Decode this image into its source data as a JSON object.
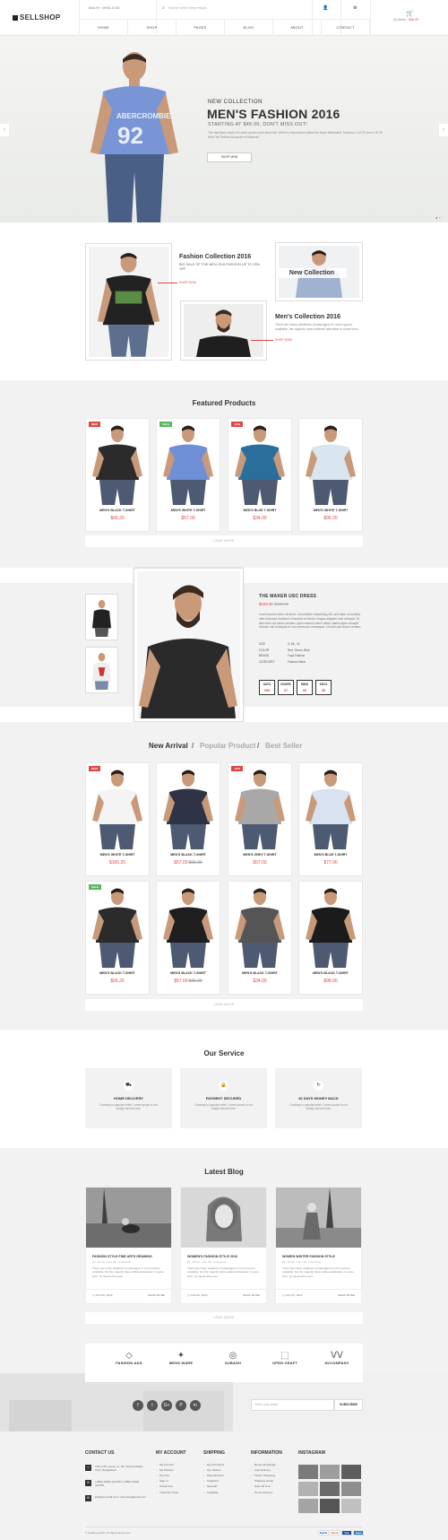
{
  "header": {
    "logo": "SELLSHOP",
    "hours": "Mon-Fri : 09:00-17:00",
    "search_placeholder": "Search within these results",
    "cart_items": "(2) items - ",
    "cart_total": "$46.00",
    "nav": [
      "HOME",
      "SHOP",
      "PAGES",
      "BLOG",
      "ABOUT",
      "CONTACT"
    ]
  },
  "hero": {
    "subtitle": "NEW COLLECTION",
    "title": "MEN'S FASHION 2016",
    "price": "STARTING AT $45.00, DON'T MISS OUT!",
    "desc": "The standard chunk of Lorem Ipsum used since the 1500s is reproduced below for those interested. Sections 1.10.32 and 1.10.33 from \"de Finibus Bonorum et Malorum\"",
    "button": "SHOP NOW"
  },
  "collections": {
    "c1_title": "Fashion Collection 2016",
    "c1_desc": "BIG SALE OF THE MEN 2016 FASHION UP TO 25% OFF",
    "c1_link": "SHOP NOW",
    "new_label": "New Collection",
    "c2_title": "Men's Collection 2016",
    "c2_desc": "There are many variations of passages of Lorem Ipsum available, the majority have suffered alteration in some form.",
    "c2_link": "SHOP NOW"
  },
  "featured": {
    "title": "Featured Products",
    "items": [
      {
        "name": "MEN'S BLACK T-SHIRT",
        "price": "$65.20",
        "badge": "NEW",
        "badge_color": "#e04848",
        "shirt": "#2b2b2b"
      },
      {
        "name": "MEN'S WHITE T-SHIRT",
        "price": "$57.00",
        "badge": "SALE",
        "badge_color": "#5cb85c",
        "shirt": "#6f8fd6"
      },
      {
        "name": "MEN'S BLUE T-SHIRT",
        "price": "$34.00",
        "badge": "-15%",
        "badge_color": "#e04848",
        "shirt": "#2a6f9c"
      },
      {
        "name": "MEN'S WHITE T-SHIRT",
        "price": "$96.20",
        "badge": "",
        "badge_color": "",
        "shirt": "#d9e6ef"
      }
    ],
    "load_more": "LOAD MORE"
  },
  "detail": {
    "title": "THE MAKER USC DRESS",
    "price": "$169.00",
    "old_price": "$189.00",
    "desc": "Lorem ipsum dolor sit amet, consectetur adipiscing elit, sed diam nonummy nibh euismod tincidunt ut laoreet et dolore magna aliquam erat volutpat. Ut wisi enim ad minim veniam, quis nostrud exerci tation ullamcorper suscipit lobortis nisl ut aliquip ex ea commodo consequat. Ut enim ad minim veniam.",
    "rows": [
      {
        "k": "SIZE",
        "v": "S, ML, XL"
      },
      {
        "k": "COLOR",
        "v": "Red, Green, Blue"
      },
      {
        "k": "BRAND",
        "v": "Fuya Fashion"
      },
      {
        "k": "CATEGORY",
        "v": "Fashion Mens"
      }
    ],
    "countdown": [
      {
        "lbl": "DAYS",
        "num": "400"
      },
      {
        "lbl": "HOURS",
        "num": "07"
      },
      {
        "lbl": "MINS",
        "num": "06"
      },
      {
        "lbl": "SECS",
        "num": "35"
      }
    ]
  },
  "tabs": {
    "new": "New Arrival",
    "sep": "/",
    "popular": "Popular Product",
    "best": "Best Seller"
  },
  "arrivals": {
    "row1": [
      {
        "name": "MEN'S WHITE T-SHIRT",
        "price": "$165.20",
        "old": "",
        "badge": "NEW",
        "badge_color": "#e04848",
        "shirt": "#f4f4f4"
      },
      {
        "name": "MEN'S BLACK T-SHIRT",
        "price": "$57.00",
        "old": "$65.00",
        "badge": "",
        "badge_color": "",
        "shirt": "#2e3446"
      },
      {
        "name": "MEN'S GREY T-SHIRT",
        "price": "$67.00",
        "old": "",
        "badge": "-15%",
        "badge_color": "#e04848",
        "shirt": "#a8a8a8"
      },
      {
        "name": "MEN'S BLUE T-SHIRT",
        "price": "$77.00",
        "old": "",
        "badge": "",
        "badge_color": "",
        "shirt": "#d9e2f0"
      }
    ],
    "row2": [
      {
        "name": "MEN'S BLACK T-SHIRT",
        "price": "$65.20",
        "old": "",
        "badge": "SALE",
        "badge_color": "#5cb85c",
        "shirt": "#2b2b2b"
      },
      {
        "name": "MEN'S BLACK T-SHIRT",
        "price": "$57.00",
        "old": "$65.00",
        "badge": "",
        "badge_color": "",
        "shirt": "#1e1e1e"
      },
      {
        "name": "MEN'S BLACK T-SHIRT",
        "price": "$34.00",
        "old": "",
        "badge": "",
        "badge_color": "",
        "shirt": "#555555"
      },
      {
        "name": "MEN'S BLACK T-SHIRT",
        "price": "$98.00",
        "old": "",
        "badge": "",
        "badge_color": "",
        "shirt": "#1b1b1b"
      }
    ],
    "load_more": "LOAD MORE"
  },
  "service": {
    "title": "Our Service",
    "items": [
      {
        "icon": "truck-icon",
        "glyph": "⛟",
        "title": "HOME DELIVERY",
        "desc": "Contrary to popular belief, Lorem Ipsum is not simply random text."
      },
      {
        "icon": "lock-icon",
        "glyph": "🔒",
        "title": "PAYMENT SECURED",
        "desc": "Contrary to popular belief, Lorem Ipsum is not simply random text."
      },
      {
        "icon": "refresh-icon",
        "glyph": "↻",
        "title": "30 DAYS MONEY BACK",
        "desc": "Contrary to popular belief, Lorem Ipsum is not simply random text."
      }
    ]
  },
  "blog": {
    "title": "Latest Blog",
    "items": [
      {
        "title": "FASHION STYLE FINE ARTS DRAWING",
        "meta": "By : Admin - Like: 48 - Comments",
        "desc": "There are many variations of passages of Lorem Ipsum available, but the majority have suffered alteration in some form, by injected humour...",
        "date": "JUN 25, 2016",
        "more": "READ MORE"
      },
      {
        "title": "WOMEN'S FASHION STYLE 2016",
        "meta": "By : Admin - Like: 48 - Comments",
        "desc": "There are many variations of passages of Lorem Ipsum available, but the majority have suffered alteration in some form, by injected humour...",
        "date": "JUN 25, 2016",
        "more": "READ MORE"
      },
      {
        "title": "WOMEN WINTER FASHION STYLE",
        "meta": "By : Admin - Like: 48 - Comments",
        "desc": "There are many variations of passages of Lorem Ipsum available, but the majority have suffered alteration in some form, by injected humour...",
        "date": "JUN 25, 2016",
        "more": "READ MORE"
      }
    ],
    "load_more": "LOAD MORE"
  },
  "brands": [
    {
      "name": "FASHION ADD",
      "glyph": "◇"
    },
    {
      "name": "MENS WARE",
      "glyph": "✦"
    },
    {
      "name": "SUBASH",
      "glyph": "◎"
    },
    {
      "name": "OPEN CRAFT",
      "glyph": "⬚"
    },
    {
      "name": "AVCOMPANY",
      "glyph": "ᐯᐯ"
    }
  ],
  "social": {
    "icons": [
      "f",
      "t",
      "G+",
      "P",
      "in"
    ],
    "newsletter_placeholder": "Enter your email",
    "subscribe": "SUBSCRIBE"
  },
  "footer": {
    "contact_title": "CONTACT US",
    "contact": [
      {
        "icon": "map-pin-icon",
        "glyph": "⌂",
        "text": "This is 85, House no. 02, Victoria Dhaka 1217, Bangladesh"
      },
      {
        "icon": "phone-icon",
        "glyph": "✆",
        "text": "(+880) 19002 421758 / (+880) 19002 421759"
      },
      {
        "icon": "mail-icon",
        "glyph": "✉",
        "text": "info@yourmail.com / username@mail.com"
      }
    ],
    "cols": [
      {
        "title": "MY ACCOUNT",
        "items": [
          "My Account",
          "My Wishlist",
          "My Cart",
          "Sign In",
          "Check Out",
          "Track My Order"
        ]
      },
      {
        "title": "SHIPPING",
        "items": [
          "New Products",
          "Top Sellers",
          "Manufactures",
          "Suppliers",
          "Specials",
          "Available"
        ]
      },
      {
        "title": "INFORMATION",
        "items": [
          "Return Exchange",
          "Fast Delivery",
          "Online Shopping",
          "Shipping Guide",
          "Sale Off Use",
          "Home Delivery"
        ]
      }
    ],
    "instagram_title": "INSTAGRAM",
    "copyright": "© Sellshop 2016. All Rights Reserved.",
    "payments": [
      "PayPal",
      "Master",
      "Visa",
      "Amex"
    ]
  }
}
